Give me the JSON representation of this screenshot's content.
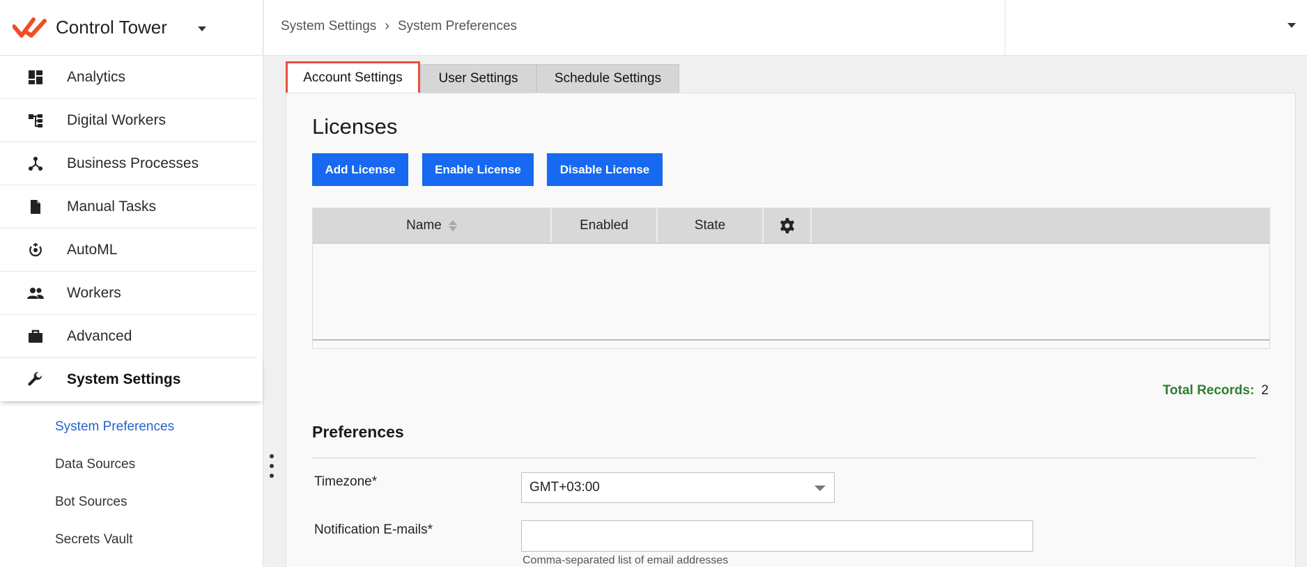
{
  "app": {
    "title": "Control Tower",
    "brand_color": "#f04e23"
  },
  "sidebar": {
    "items": [
      {
        "label": "Analytics",
        "icon": "dashboard-icon"
      },
      {
        "label": "Digital Workers",
        "icon": "hierarchy-icon"
      },
      {
        "label": "Business Processes",
        "icon": "process-graph-icon"
      },
      {
        "label": "Manual Tasks",
        "icon": "document-icon"
      },
      {
        "label": "AutoML",
        "icon": "brain-icon"
      },
      {
        "label": "Workers",
        "icon": "people-icon"
      },
      {
        "label": "Advanced",
        "icon": "briefcase-icon"
      },
      {
        "label": "System Settings",
        "icon": "wrench-icon"
      }
    ],
    "subitems": [
      {
        "label": "System Preferences"
      },
      {
        "label": "Data Sources"
      },
      {
        "label": "Bot Sources"
      },
      {
        "label": "Secrets Vault"
      }
    ]
  },
  "breadcrumb": {
    "items": [
      "System Settings",
      "System Preferences"
    ],
    "separator": ">"
  },
  "tabs": [
    {
      "label": "Account Settings"
    },
    {
      "label": "User Settings"
    },
    {
      "label": "Schedule Settings"
    }
  ],
  "licenses": {
    "title": "Licenses",
    "buttons": {
      "add": "Add License",
      "enable": "Enable License",
      "disable": "Disable License"
    },
    "columns": [
      "Name",
      "Enabled",
      "State"
    ],
    "rows": [],
    "total_label": "Total Records:",
    "total_value": "2"
  },
  "preferences": {
    "title": "Preferences",
    "timezone_label": "Timezone*",
    "timezone_value": "GMT+03:00",
    "emails_label": "Notification E-mails*",
    "emails_value": "",
    "emails_hint": "Comma-separated list of email addresses"
  },
  "colors": {
    "primary_button": "#1669f0",
    "active_tab_outline": "#e8513a",
    "total_label": "#2e7d32",
    "active_subitem": "#2563c9"
  }
}
